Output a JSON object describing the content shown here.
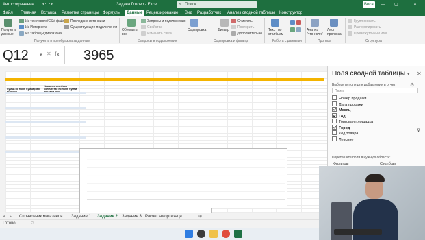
{
  "titlebar": {
    "autosave_label": "Автосохранение",
    "doc_title": "Задача Готово - Excel",
    "search_placeholder": "Поиск",
    "user_badge": "Веса",
    "share_label": "Общий доступ"
  },
  "menu": {
    "tabs": [
      "Файл",
      "Главная",
      "Вставка",
      "Разметка страницы",
      "Формулы",
      "Данные",
      "Рецензирование",
      "Вид",
      "Разработчик",
      "Анализ сводной таблицы",
      "Конструктор"
    ],
    "active_index": 5
  },
  "ribbon": {
    "get_data": "Получить данные",
    "from_text_csv": "Из текстового/CSV-файла",
    "from_web": "Из Интернета",
    "from_table": "Из таблицы/диапазона",
    "recent_sources": "Последние источники",
    "existing_connections": "Существующие подключения",
    "group_get_transform": "Получить и преобразовать данные",
    "refresh_all": "Обновить все",
    "queries_connections": "Запросы и подключения",
    "properties": "Свойства",
    "edit_links": "Изменить связи",
    "group_queries": "Запросы и подключения",
    "sort": "Сортировка",
    "filter": "Фильтр",
    "clear": "Очистить",
    "reapply": "Повторить",
    "advanced": "Дополнительно",
    "group_sort_filter": "Сортировка и фильтр",
    "text_to_columns": "Текст по столбцам",
    "group_data_tools": "Работа с данными",
    "what_if": "Анализ \"что если\"",
    "forecast_sheet": "Лист прогноза",
    "group_forecast": "Прогноз",
    "group": "Группировать",
    "ungroup": "Разгруппировать",
    "subtotal": "Промежуточный итог",
    "group_outline": "Структура"
  },
  "formula_bar": {
    "name_box": "Q12",
    "fx": "fx",
    "value": "3965"
  },
  "pivot_pane": {
    "title": "Поля сводной таблицы",
    "subtitle": "Выберите поля для добавления в отчет:",
    "search_placeholder": "Поиск",
    "fields": [
      {
        "label": "Номер продажи",
        "checked": false
      },
      {
        "label": "Дата продажи",
        "checked": false
      },
      {
        "label": "Месяц",
        "checked": true
      },
      {
        "label": "Год",
        "checked": true
      },
      {
        "label": "Торговая площадка",
        "checked": false
      },
      {
        "label": "Город",
        "checked": true
      },
      {
        "label": "Код товара",
        "checked": false
      },
      {
        "label": "Левсине",
        "checked": false
      }
    ],
    "drag_hint": "Перетащите поля в нужную область:",
    "filters_label": "Фильтры",
    "columns_label": "Столбцы"
  },
  "sheet_tabs": {
    "tabs": [
      "Справочник магазинов",
      "Задание 1",
      "Задание 2",
      "Задание 3",
      "Расчет амортизаци ..."
    ],
    "active_index": 2
  },
  "status": {
    "ready": "Готово"
  },
  "sheet": {
    "pivot_headers": {
      "col_a": "Сумма по полю Суммарная выручка",
      "col_b": "Названия столбцов",
      "col_c": "Количество по полю Сумма продажи, руб."
    }
  },
  "chart_data": {
    "type": "bar",
    "title": "",
    "categories": [],
    "series": [],
    "grid": true,
    "legend": "right"
  },
  "colors": {
    "excel_green": "#1e6f3f",
    "pivot_header_yellow": "#f4b400",
    "series_colors": [
      "#4472c4",
      "#ed7d31",
      "#a5a5a5",
      "#ffc000",
      "#5b9bd5",
      "#70ad47",
      "#264478",
      "#9e480e"
    ]
  }
}
